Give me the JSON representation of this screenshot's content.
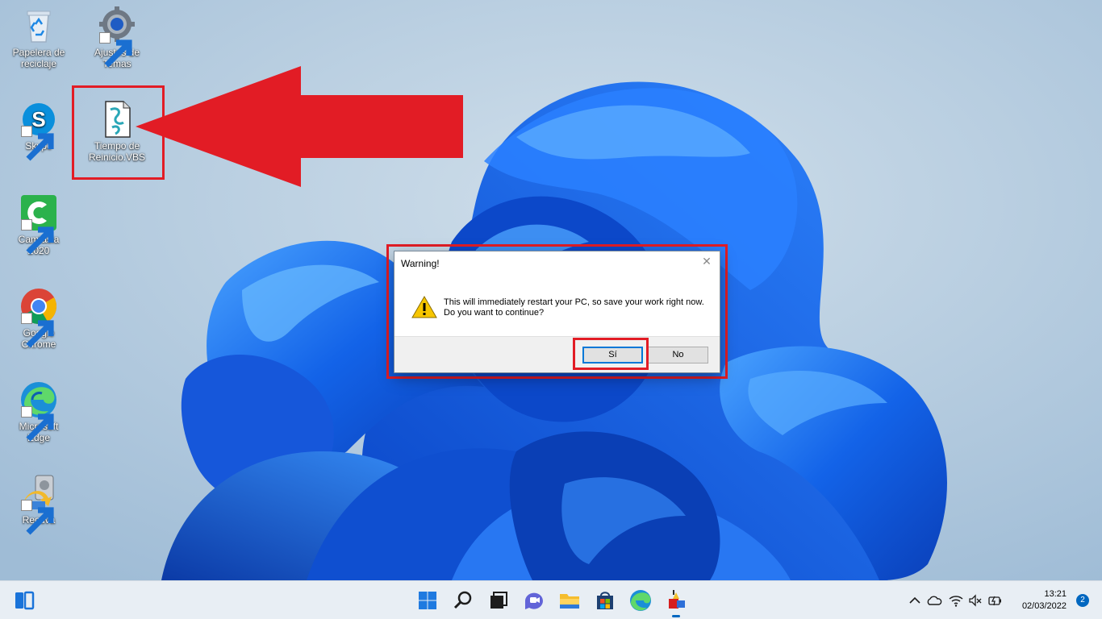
{
  "desktop": {
    "icons": [
      {
        "label": "Papelera de reciclaje"
      },
      {
        "label": "Ajustes de Temas"
      },
      {
        "label": "Skype"
      },
      {
        "label": "Tiempo de Reinicio.VBS"
      },
      {
        "label": "Camtasia 2020"
      },
      {
        "label": "Google Chrome"
      },
      {
        "label": "Microsoft Edge"
      },
      {
        "label": "Recuva"
      }
    ]
  },
  "dialog": {
    "title": "Warning!",
    "message": "This will immediately restart your PC, so save your work right now. Do you want to continue?",
    "yes_label": "Sí",
    "no_label": "No",
    "close_glyph": "✕"
  },
  "taskbar": {
    "time": "13:21",
    "date": "02/03/2022",
    "notification_count": "2"
  },
  "colors": {
    "highlight": "#e21c25",
    "accent": "#0067c0",
    "wallpaper_bloom": "#1a64e6"
  }
}
